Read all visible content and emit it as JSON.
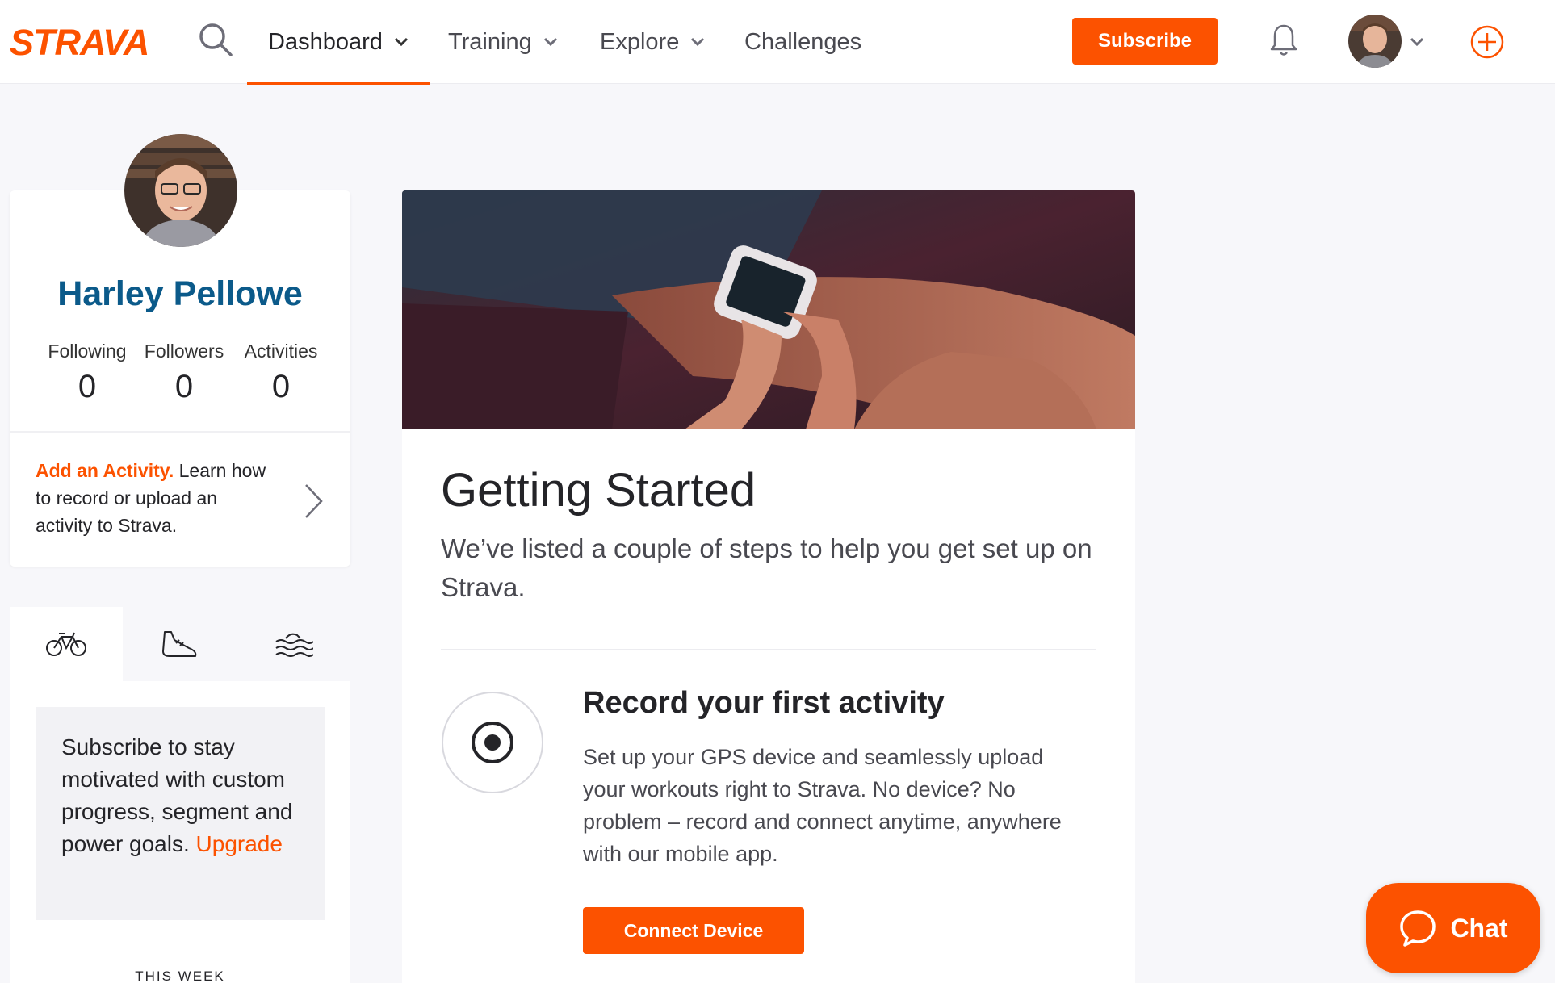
{
  "header": {
    "logo_text": "STRAVA",
    "nav": [
      {
        "label": "Dashboard",
        "has_dropdown": true,
        "active": true
      },
      {
        "label": "Training",
        "has_dropdown": true,
        "active": false
      },
      {
        "label": "Explore",
        "has_dropdown": true,
        "active": false
      },
      {
        "label": "Challenges",
        "has_dropdown": false,
        "active": false
      }
    ],
    "subscribe_label": "Subscribe",
    "icons": {
      "search": "search-icon",
      "notifications": "bell-icon",
      "profile_menu": "chevron-down-icon",
      "upload": "plus-circle-icon"
    }
  },
  "profile": {
    "name": "Harley Pellowe",
    "stats": [
      {
        "label": "Following",
        "value": "0"
      },
      {
        "label": "Followers",
        "value": "0"
      },
      {
        "label": "Activities",
        "value": "0"
      }
    ],
    "add_activity": {
      "highlight": "Add an Activity.",
      "text": " Learn how to record or upload an activity to Strava."
    }
  },
  "sport_tabs": [
    {
      "name": "cycling",
      "icon": "bicycle-icon",
      "active": true
    },
    {
      "name": "running",
      "icon": "shoe-icon",
      "active": false
    },
    {
      "name": "swimming",
      "icon": "waves-icon",
      "active": false
    }
  ],
  "upsell": {
    "text": "Subscribe to stay motivated with custom progress, segment and power goals. ",
    "link": "Upgrade"
  },
  "this_week_label": "THIS WEEK",
  "getting_started": {
    "title": "Getting Started",
    "description": "We’ve listed a couple of steps to help you get set up on Strava.",
    "step": {
      "title": "Record your first activity",
      "description": "Set up your GPS device and seamlessly upload your workouts right to Strava. No device? No problem – record and connect anytime, anywhere with our mobile app.",
      "button": "Connect Device"
    }
  },
  "chat": {
    "label": "Chat"
  },
  "colors": {
    "brand": "#fc5200",
    "name": "#0b5a8a",
    "background": "#f7f7fa"
  }
}
